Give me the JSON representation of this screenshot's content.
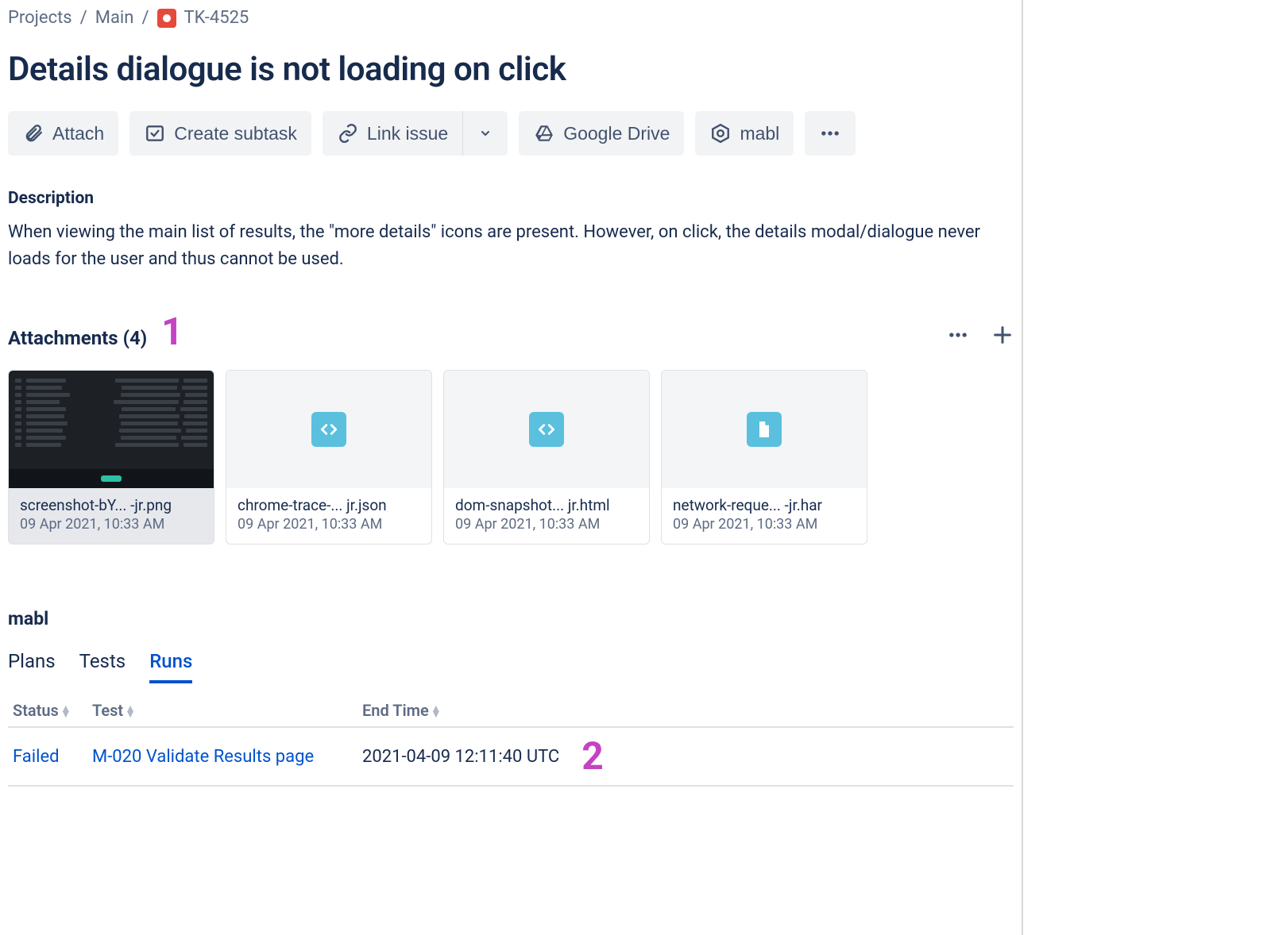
{
  "breadcrumb": {
    "projects": "Projects",
    "project": "Main",
    "issue": "TK-4525"
  },
  "title": "Details dialogue is not loading on click",
  "toolbar": {
    "attach": "Attach",
    "create_subtask": "Create subtask",
    "link_issue": "Link issue",
    "google_drive": "Google Drive",
    "mabl": "mabl"
  },
  "description": {
    "label": "Description",
    "text": "When viewing the main list of results, the \"more details\" icons are present. However, on click, the details modal/dialogue never loads for the user and thus cannot be used."
  },
  "attachments": {
    "title": "Attachments (4)",
    "callout": "1",
    "items": [
      {
        "name": "screenshot-bY... -jr.png",
        "date": "09 Apr 2021, 10:33 AM",
        "kind": "image"
      },
      {
        "name": "chrome-trace-... jr.json",
        "date": "09 Apr 2021, 10:33 AM",
        "kind": "code"
      },
      {
        "name": "dom-snapshot... jr.html",
        "date": "09 Apr 2021, 10:33 AM",
        "kind": "code"
      },
      {
        "name": "network-reque... -jr.har",
        "date": "09 Apr 2021, 10:33 AM",
        "kind": "doc"
      }
    ]
  },
  "mabl": {
    "title": "mabl",
    "tabs": {
      "plans": "Plans",
      "tests": "Tests",
      "runs": "Runs"
    },
    "headers": {
      "status": "Status",
      "test": "Test",
      "end_time": "End Time"
    },
    "row": {
      "status": "Failed",
      "test": "M-020 Validate Results page",
      "end_time": "2021-04-09 12:11:40 UTC"
    },
    "callout": "2"
  }
}
